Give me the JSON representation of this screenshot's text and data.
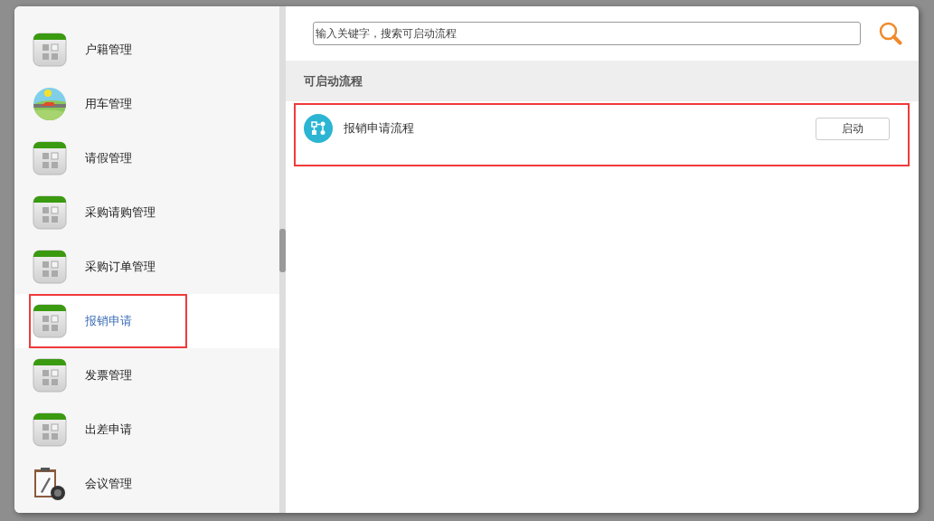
{
  "sidebar": {
    "items": [
      {
        "label": "户籍管理",
        "kind": "app",
        "selected": false,
        "annotated": false
      },
      {
        "label": "用车管理",
        "kind": "car",
        "selected": false,
        "annotated": false
      },
      {
        "label": "请假管理",
        "kind": "app",
        "selected": false,
        "annotated": false
      },
      {
        "label": "采购请购管理",
        "kind": "app",
        "selected": false,
        "annotated": false
      },
      {
        "label": "采购订单管理",
        "kind": "app",
        "selected": false,
        "annotated": false
      },
      {
        "label": "报销申请",
        "kind": "app",
        "selected": true,
        "annotated": true
      },
      {
        "label": "发票管理",
        "kind": "app",
        "selected": false,
        "annotated": false
      },
      {
        "label": "出差申请",
        "kind": "app",
        "selected": false,
        "annotated": false
      },
      {
        "label": "会议管理",
        "kind": "meeting",
        "selected": false,
        "annotated": false
      }
    ]
  },
  "search": {
    "placeholder": "输入关键字，搜索可启动流程"
  },
  "section_title": "可启动流程",
  "processes": [
    {
      "name": "报销申请流程",
      "button": "启动",
      "annotated": true
    }
  ]
}
